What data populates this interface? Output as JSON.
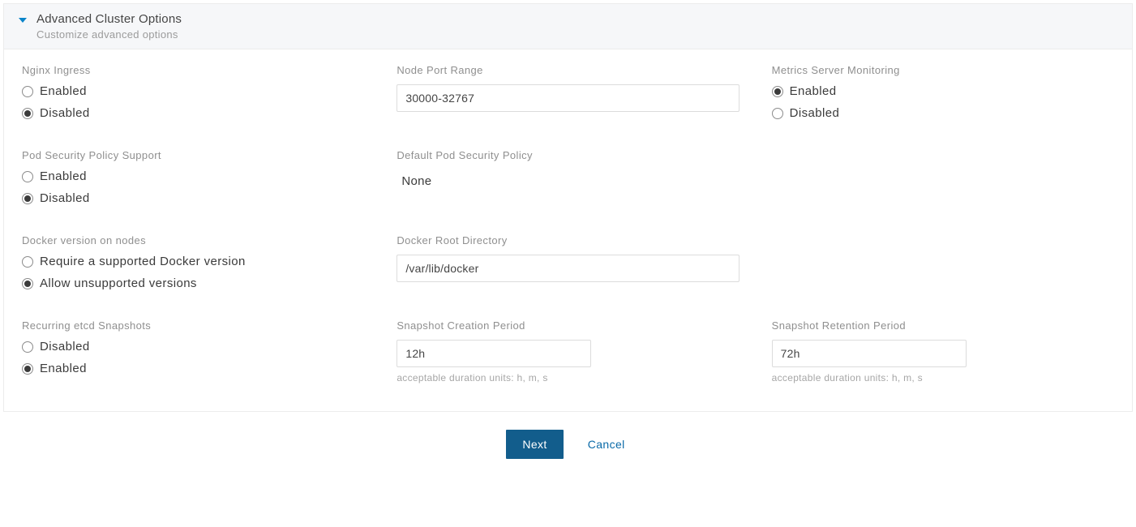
{
  "header": {
    "title": "Advanced Cluster Options",
    "subtitle": "Customize advanced options"
  },
  "labels": {
    "enabled": "Enabled",
    "disabled": "Disabled"
  },
  "nginx_ingress": {
    "label": "Nginx Ingress",
    "selected": "disabled"
  },
  "node_port_range": {
    "label": "Node Port Range",
    "value": "30000-32767"
  },
  "metrics_server": {
    "label": "Metrics Server Monitoring",
    "selected": "enabled"
  },
  "pod_security": {
    "label": "Pod Security Policy Support",
    "selected": "disabled"
  },
  "default_psp": {
    "label": "Default Pod Security Policy",
    "value": "None"
  },
  "docker_version": {
    "label": "Docker version on nodes",
    "option_require": "Require a supported Docker version",
    "option_allow": "Allow unsupported versions",
    "selected": "allow"
  },
  "docker_root": {
    "label": "Docker Root Directory",
    "value": "/var/lib/docker"
  },
  "etcd_snapshots": {
    "label": "Recurring etcd Snapshots",
    "selected": "enabled"
  },
  "snapshot_creation": {
    "label": "Snapshot Creation Period",
    "value": "12h",
    "hint": "acceptable duration units: h, m, s"
  },
  "snapshot_retention": {
    "label": "Snapshot Retention Period",
    "value": "72h",
    "hint": "acceptable duration units: h, m, s"
  },
  "footer": {
    "next": "Next",
    "cancel": "Cancel"
  }
}
